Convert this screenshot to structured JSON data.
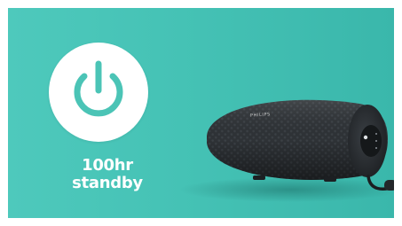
{
  "standby": {
    "line1": "100hr",
    "line2": "standby"
  },
  "product": {
    "brand": "PHILIPS"
  },
  "icons": {
    "badge": "power-icon"
  },
  "colors": {
    "background": "#45c2b5",
    "badge": "#ffffff",
    "power_symbol": "#4bc4b6",
    "speaker_body": "#2b2f33",
    "caption_text": "#ffffff"
  }
}
